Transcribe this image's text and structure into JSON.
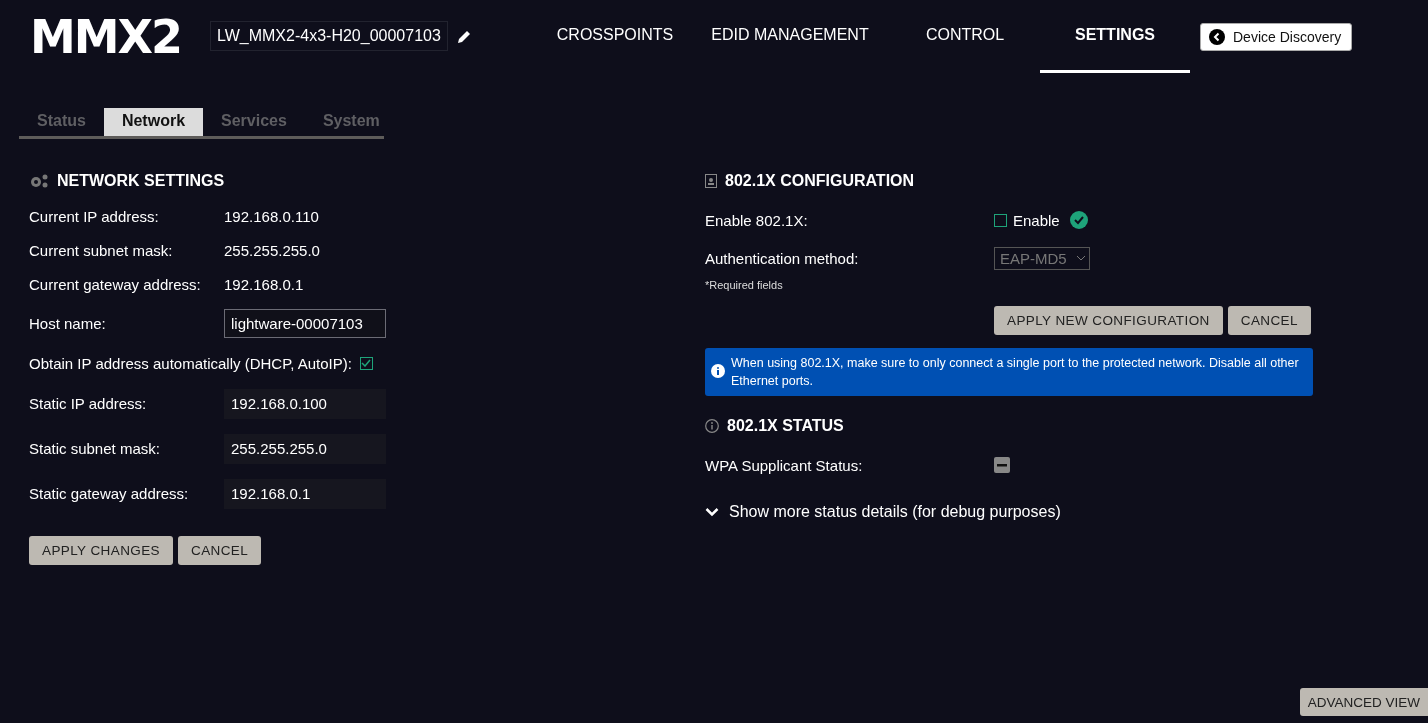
{
  "header": {
    "logo": "MMX2",
    "device_name": "LW_MMX2-4x3-H20_00007103",
    "nav": [
      {
        "label": "CROSSPOINTS",
        "selected": false
      },
      {
        "label": "EDID MANAGEMENT",
        "selected": false
      },
      {
        "label": "CONTROL",
        "selected": false
      },
      {
        "label": "SETTINGS",
        "selected": true
      }
    ],
    "discovery_button": "Device Discovery"
  },
  "tabs": [
    {
      "label": "Status",
      "selected": false
    },
    {
      "label": "Network",
      "selected": true
    },
    {
      "label": "Services",
      "selected": false
    },
    {
      "label": "System",
      "selected": false
    }
  ],
  "network_settings": {
    "title": "NETWORK SETTINGS",
    "rows": [
      {
        "kind": "text",
        "label": "Current IP address:",
        "value": "192.168.0.110"
      },
      {
        "kind": "text",
        "label": "Current subnet mask:",
        "value": "255.255.255.0"
      },
      {
        "kind": "text",
        "label": "Current gateway address:",
        "value": "192.168.0.1"
      },
      {
        "kind": "input",
        "label": "Host name:",
        "value": "lightware-00007103",
        "disabled": false
      },
      {
        "kind": "checkbox",
        "label": "Obtain IP address automatically (DHCP, AutoIP):",
        "checked": true
      },
      {
        "kind": "input",
        "label": "Static IP address:",
        "value": "192.168.0.100",
        "disabled": true
      },
      {
        "kind": "input",
        "label": "Static subnet mask:",
        "value": "255.255.255.0",
        "disabled": true
      },
      {
        "kind": "input",
        "label": "Static gateway address:",
        "value": "192.168.0.1",
        "disabled": true
      }
    ],
    "buttons": [
      "APPLY CHANGES",
      "CANCEL"
    ]
  },
  "config_8021x": {
    "title": "802.1X CONFIGURATION",
    "enable_label": "Enable 802.1X:",
    "enable_text": "Enable",
    "enable_checked": false,
    "auth_label": "Authentication method:",
    "auth_value": "EAP-MD5",
    "required_note": "*Required fields",
    "buttons": [
      "APPLY NEW CONFIGURATION",
      "CANCEL"
    ],
    "info": "When using 802.1X, make sure to only connect a single port to the protected network. Disable all other Ethernet ports."
  },
  "status_8021x": {
    "title": "802.1X STATUS",
    "wpa_label": "WPA Supplicant Status:",
    "details_toggle": "Show more status details (for debug purposes)",
    "expanded": false
  },
  "advanced_button": "ADVANCED VIEW"
}
